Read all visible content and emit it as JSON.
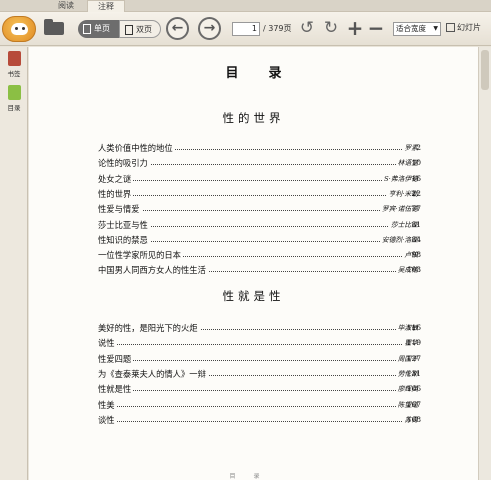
{
  "tabs": [
    "阅读",
    "注释"
  ],
  "toolbar": {
    "single_page": "单页",
    "double_page": "双页",
    "current_page": "1",
    "total_pages": "/ 379页",
    "fit": "适合宽度",
    "slideshow": "幻灯片"
  },
  "sidebar": {
    "bookmark": "书签",
    "toc": "目录"
  },
  "doc": {
    "title": "目录",
    "sections": [
      {
        "title": "性的世界",
        "entries": [
          {
            "title": "人类价值中性的地位",
            "author": "罗素",
            "page": "2"
          },
          {
            "title": "论性的吸引力",
            "author": "林语堂",
            "page": "10"
          },
          {
            "title": "处女之谜",
            "author": "S·弗洛伊德",
            "page": "16"
          },
          {
            "title": "性的世界",
            "author": "亨利·米勒",
            "page": "22"
          },
          {
            "title": "性爱与情爱",
            "author": "罗宾·诺伍德",
            "page": "77"
          },
          {
            "title": "莎士比亚与性",
            "author": "莎士比亚",
            "page": "81"
          },
          {
            "title": "性知识的禁忌",
            "author": "安德烈·洛亚",
            "page": "84"
          },
          {
            "title": "一位性学家所见的日本",
            "author": "卢梭",
            "page": "98"
          },
          {
            "title": "中国男人同西方女人的性生活",
            "author": "吴成格",
            "page": "103"
          }
        ]
      },
      {
        "title": "性就是性",
        "entries": [
          {
            "title": "美好的性，是阳光下的火炬",
            "author": "毕淑敏",
            "page": "116"
          },
          {
            "title": "说性",
            "author": "瞿华",
            "page": "119"
          },
          {
            "title": "性爱四题",
            "author": "周国平",
            "page": "127"
          },
          {
            "title": "为《查泰莱夫人的情人》一辩",
            "author": "劳伦斯",
            "page": "131"
          },
          {
            "title": "性就是性",
            "author": "廖辉英",
            "page": "166"
          },
          {
            "title": "性美",
            "author": "陈望道",
            "page": "167"
          },
          {
            "title": "谈性",
            "author": "苏青",
            "page": "168"
          }
        ]
      }
    ],
    "footer": "目录"
  }
}
